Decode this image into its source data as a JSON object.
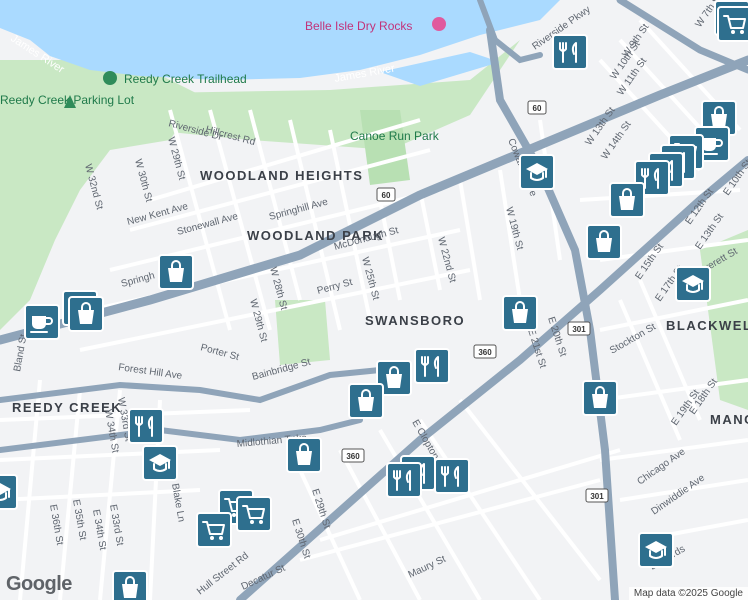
{
  "map": {
    "water": {
      "river_name": "James River"
    },
    "pois": [
      {
        "name": "Belle Isle Dry Rocks"
      },
      {
        "name": "Reedy Creek Trailhead"
      },
      {
        "name": "Reedy Creek Parking Lot"
      }
    ],
    "parks": [
      {
        "name": "Canoe Run Park"
      }
    ],
    "neighborhoods": [
      "WOODLAND HEIGHTS",
      "WOODLAND PARK",
      "SWANSBORO",
      "REEDY CREEK",
      "BLACKWELL",
      "MANC"
    ],
    "streets": [
      "Riverside Dr",
      "Hillcrest Rd",
      "W 29th St",
      "W 30th St",
      "W 32nd St",
      "New Kent Ave",
      "Stonewall Ave",
      "Springhill Ave",
      "McDonough St",
      "Perry St",
      "W 25th St",
      "W 28th St",
      "W 29th St",
      "Porter St",
      "Bainbridge St",
      "Forest Hill Ave",
      "W 22nd St",
      "W 19th St",
      "Cowardin Ave",
      "Hull Street Rd",
      "Midlothian Tpke",
      "Maury St",
      "Decatur St",
      "E 20th St",
      "E 21st St",
      "E 29th St",
      "E 30th St",
      "E 33rd St",
      "E 34th St",
      "E 35th St",
      "E 36th St",
      "W 33rd St",
      "W 34th St",
      "Blake Ln",
      "Bland St",
      "Everett St",
      "Stockton St",
      "Chicago Ave",
      "Dinwiddie Ave",
      "Riverside Pkwy",
      "W 7th St",
      "W 9th St",
      "W 10th St",
      "W 11th St",
      "W 13th St",
      "W 14th St",
      "E 10th St",
      "E 12th St",
      "E 13th St",
      "E 15th St",
      "E 17th St",
      "E 18th St",
      "E 19th St",
      "E Clopton St",
      "Edwards",
      "Springh"
    ],
    "route_shields": [
      "60",
      "60",
      "360",
      "360",
      "301",
      "301"
    ],
    "google_logo": "Google",
    "map_credit": "Map data ©2025 Google"
  },
  "markers": [
    {
      "kind": "restaurant",
      "icon": "fork-knife-icon"
    },
    {
      "kind": "shopping",
      "icon": "shopping-bag-icon"
    },
    {
      "kind": "school",
      "icon": "graduation-cap-icon"
    },
    {
      "kind": "grocery",
      "icon": "shopping-cart-icon"
    },
    {
      "kind": "cafe",
      "icon": "coffee-cup-icon"
    }
  ],
  "colors": {
    "water": "#aadaff",
    "park": "#c9e8c4",
    "road_major": "#8fa4b9",
    "road_minor": "#ffffff",
    "land": "#f2f3f5",
    "marker": "#2e6f8e",
    "poi_pink": "#e05a9e"
  }
}
